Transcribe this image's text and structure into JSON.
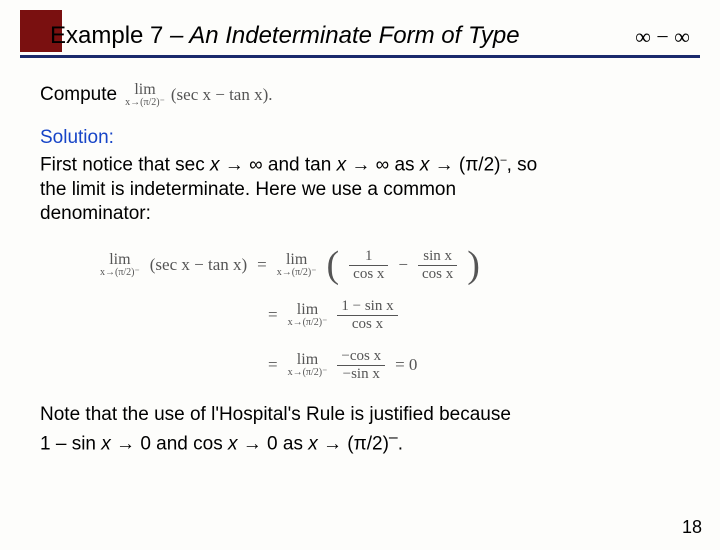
{
  "title": {
    "prefix": "Example 7",
    "dash": " – ",
    "rest": "An Indeterminate Form of Type",
    "math": "∞ − ∞"
  },
  "compute": {
    "label": "Compute",
    "lim": "lim",
    "sub": "x→(π/2)⁻",
    "expr": "(sec x − tan x).",
    "trailing": ""
  },
  "solution": {
    "label": "Solution:",
    "line1a": "First notice that sec ",
    "x1": "x",
    "arrow1": " → ∞ and tan ",
    "x2": "x",
    "arrow2": " → ∞  as ",
    "x3": "x",
    "arrow3": " → (π/2)",
    "sup1": "–",
    "line1end": ", so",
    "line2": "the limit is indeterminate. Here we use a common",
    "line3": "denominator:"
  },
  "math": {
    "lim": "lim",
    "sub": "x→(π/2)⁻",
    "lhs": "(sec x − tan x)",
    "eq": "=",
    "frac1n": "1",
    "frac1d": "cos x",
    "minus": "−",
    "frac2n": "sin x",
    "frac2d": "cos x",
    "frac3n": "1 − sin x",
    "frac3d": "cos x",
    "frac4n": "−cos x",
    "frac4d": "−sin x",
    "zero": "= 0"
  },
  "note": {
    "line1": "Note that the use of l'Hospital's Rule is justified because",
    "line2a": "1 – sin ",
    "x1": "x",
    "mid1": " → 0 and cos ",
    "x2": "x",
    "mid2": " → 0 as ",
    "x3": "x",
    "mid3": " → (π/2)",
    "sup": "–",
    "end": "."
  },
  "page": "18"
}
